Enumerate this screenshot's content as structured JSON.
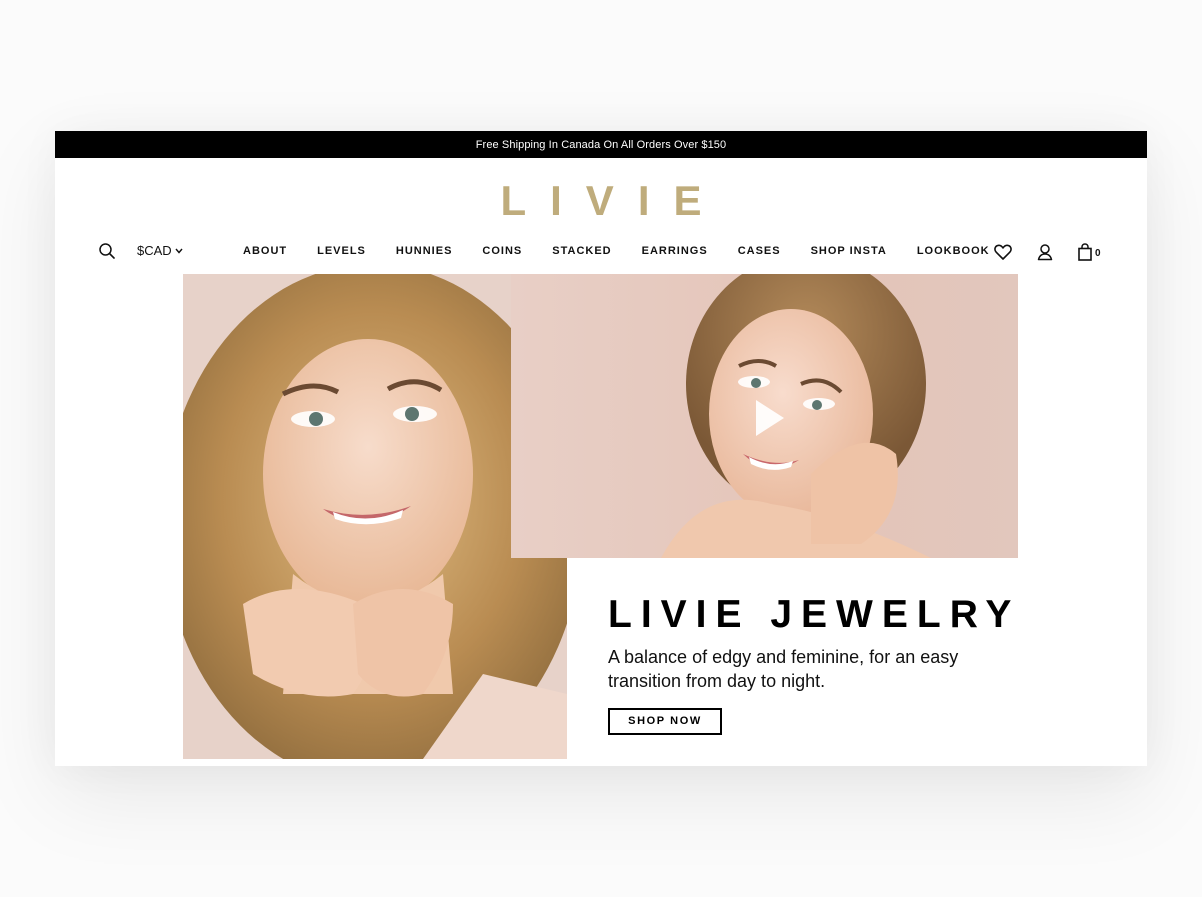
{
  "announcement": "Free Shipping In Canada On All Orders Over $150",
  "brand": "LIVIE",
  "header": {
    "currency": "$CAD",
    "nav": [
      "ABOUT",
      "LEVELS",
      "HUNNIES",
      "COINS",
      "STACKED",
      "EARRINGS",
      "CASES",
      "SHOP INSTA",
      "LOOKBOOK"
    ],
    "cart_count": "0"
  },
  "hero": {
    "title": "LIVIE JEWELRY",
    "subtitle": "A balance of edgy and feminine, for an easy transition from day to night.",
    "cta": "SHOP NOW"
  },
  "colors": {
    "brand_gold": "#bfac7c",
    "announcement_bg": "#000000"
  },
  "icons": [
    "search-icon",
    "chevron-down-icon",
    "heart-icon",
    "user-icon",
    "shopping-bag-icon",
    "play-icon"
  ]
}
